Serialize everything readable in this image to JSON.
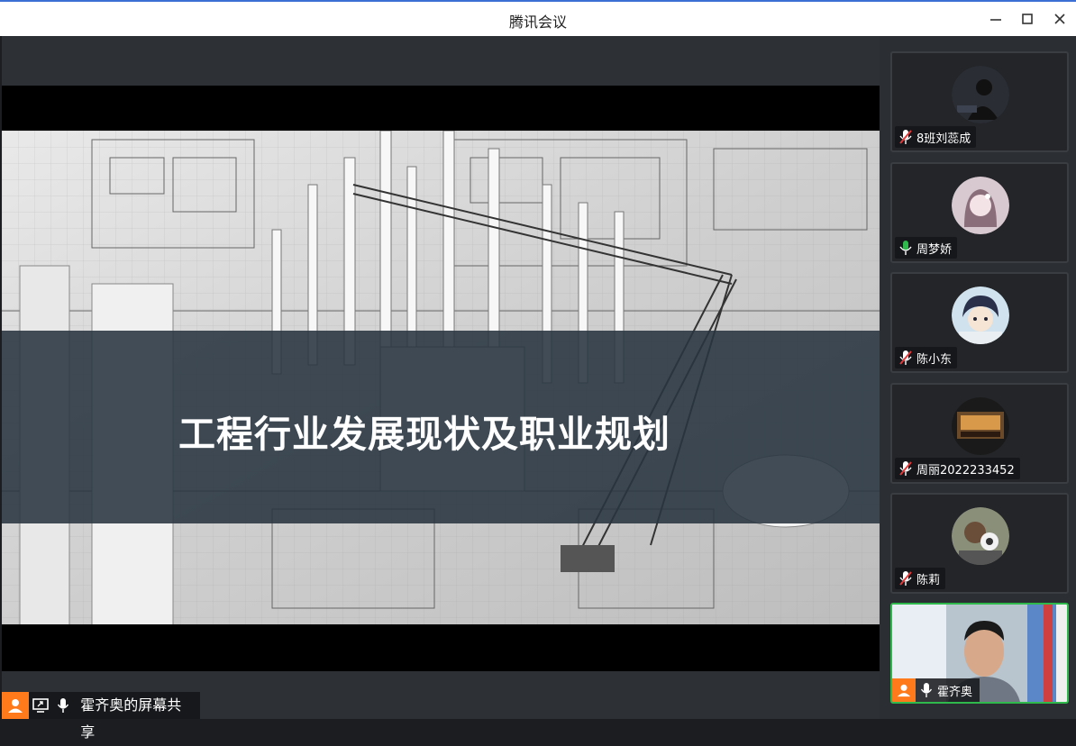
{
  "window": {
    "title": "腾讯会议"
  },
  "slide": {
    "title": "工程行业发展现状及职业规划"
  },
  "share_bar": {
    "label": "霍齐奥的屏幕共享"
  },
  "participants": [
    {
      "name": "8班刘蕊成",
      "muted": true
    },
    {
      "name": "周梦娇",
      "muted": false
    },
    {
      "name": "陈小东",
      "muted": true
    },
    {
      "name": "周丽2022233452",
      "muted": true
    },
    {
      "name": "陈莉",
      "muted": true
    }
  ],
  "self": {
    "name": "霍齐奥",
    "muted": false
  },
  "colors": {
    "accent_green": "#2fb84b",
    "muted_red": "#e33b3b",
    "self_orange": "#ff7a1a"
  }
}
